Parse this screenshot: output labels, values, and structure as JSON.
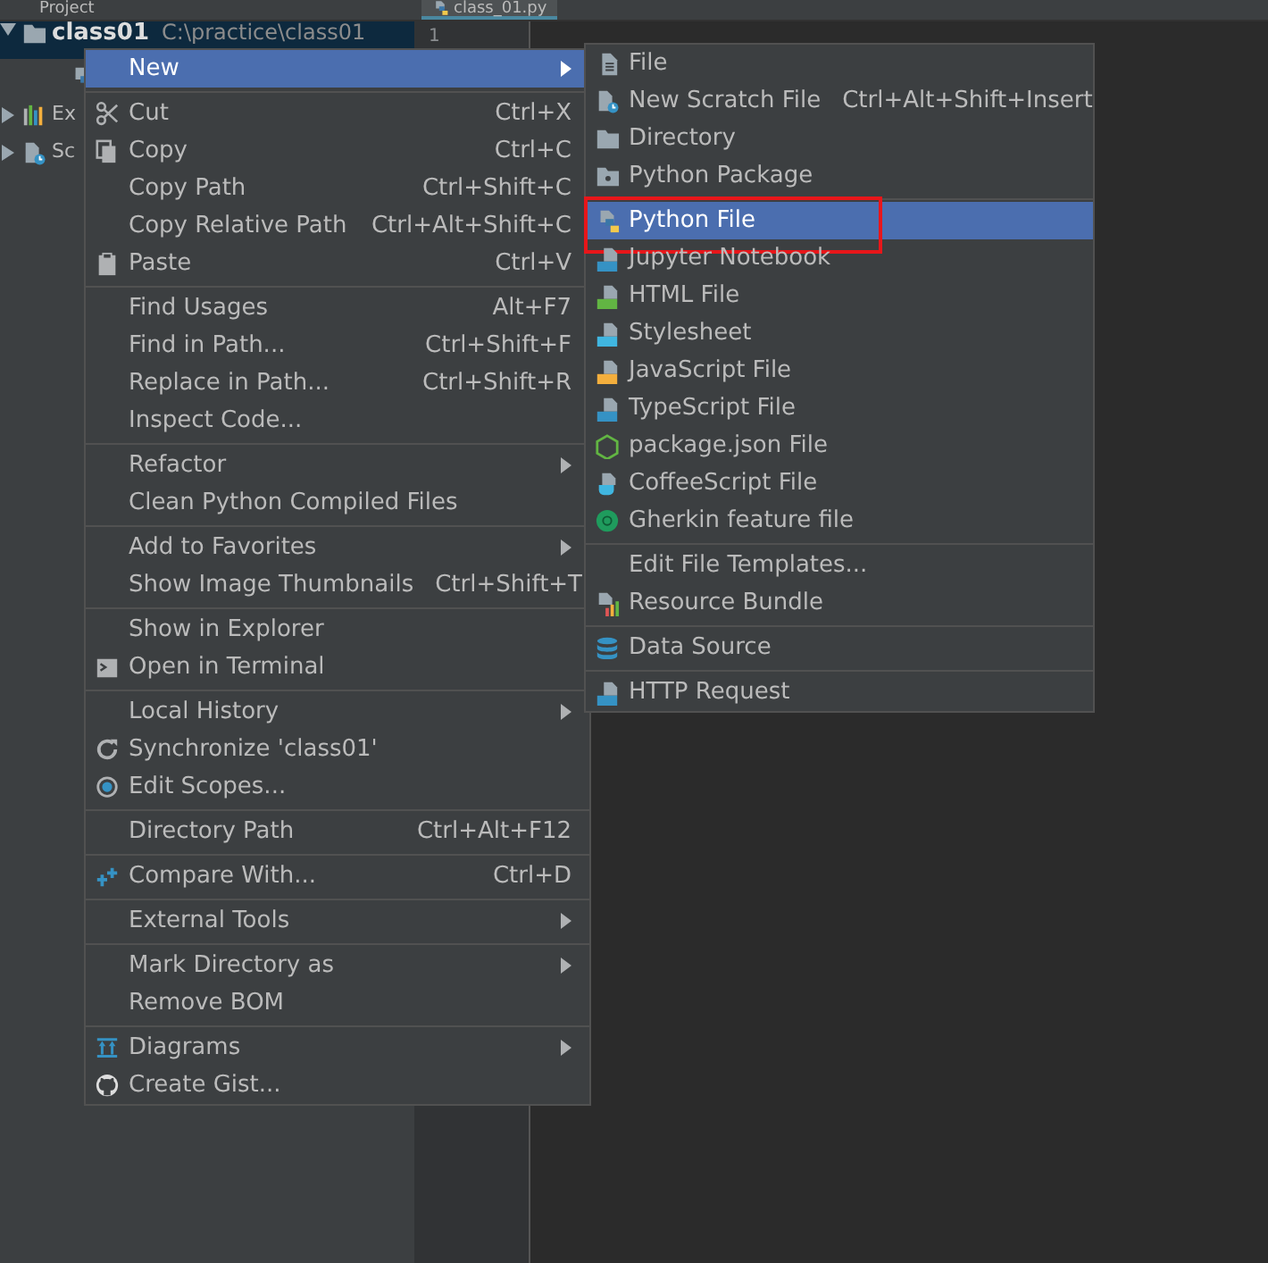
{
  "toolbar": {
    "title": "Project"
  },
  "editor_tab": {
    "label": "class_01.py"
  },
  "gutter": {
    "line": "1"
  },
  "project_tree": [
    {
      "kind": "folder",
      "label": "class01",
      "path": "C:\\practice\\class01",
      "selected": true,
      "expanded": true,
      "children": [
        {
          "kind": "python",
          "selected": false
        }
      ]
    },
    {
      "kind": "bars",
      "label": "Ex",
      "selected": false,
      "expanded": false
    },
    {
      "kind": "scratch",
      "label": "Sc",
      "selected": false,
      "expanded": false
    }
  ],
  "context_menu": [
    [
      {
        "label": "New",
        "kind": "plain",
        "submenu": true,
        "selected": true
      }
    ],
    [
      {
        "label": "Cut",
        "shortcut": "Ctrl+X",
        "kind": "scissors",
        "selected": false
      },
      {
        "label": "Copy",
        "shortcut": "Ctrl+C",
        "kind": "copy",
        "selected": false
      },
      {
        "label": "Copy Path",
        "shortcut": "Ctrl+Shift+C",
        "kind": "plain",
        "selected": false
      },
      {
        "label": "Copy Relative Path",
        "shortcut": "Ctrl+Alt+Shift+C",
        "kind": "plain",
        "selected": false
      },
      {
        "label": "Paste",
        "shortcut": "Ctrl+V",
        "kind": "paste",
        "selected": false
      }
    ],
    [
      {
        "label": "Find Usages",
        "shortcut": "Alt+F7",
        "kind": "plain",
        "selected": false
      },
      {
        "label": "Find in Path...",
        "shortcut": "Ctrl+Shift+F",
        "kind": "plain",
        "selected": false
      },
      {
        "label": "Replace in Path...",
        "shortcut": "Ctrl+Shift+R",
        "kind": "plain",
        "selected": false
      },
      {
        "label": "Inspect Code...",
        "kind": "plain",
        "selected": false
      }
    ],
    [
      {
        "label": "Refactor",
        "kind": "plain",
        "submenu": true,
        "selected": false
      },
      {
        "label": "Clean Python Compiled Files",
        "kind": "plain",
        "selected": false
      }
    ],
    [
      {
        "label": "Add to Favorites",
        "kind": "plain",
        "submenu": true,
        "selected": false
      },
      {
        "label": "Show Image Thumbnails",
        "shortcut": "Ctrl+Shift+T",
        "kind": "plain",
        "selected": false
      }
    ],
    [
      {
        "label": "Show in Explorer",
        "kind": "plain",
        "selected": false
      },
      {
        "label": "Open in Terminal",
        "kind": "terminal",
        "selected": false
      }
    ],
    [
      {
        "label": "Local History",
        "kind": "plain",
        "submenu": true,
        "selected": false
      },
      {
        "label": "Synchronize 'class01'",
        "kind": "sync",
        "selected": false
      },
      {
        "label": "Edit Scopes...",
        "kind": "scope",
        "selected": false
      }
    ],
    [
      {
        "label": "Directory Path",
        "shortcut": "Ctrl+Alt+F12",
        "kind": "plain",
        "selected": false
      }
    ],
    [
      {
        "label": "Compare With...",
        "shortcut": "Ctrl+D",
        "kind": "compare",
        "selected": false
      }
    ],
    [
      {
        "label": "External Tools",
        "kind": "plain",
        "submenu": true,
        "selected": false
      }
    ],
    [
      {
        "label": "Mark Directory as",
        "kind": "plain",
        "submenu": true,
        "selected": false
      },
      {
        "label": "Remove BOM",
        "kind": "plain",
        "selected": false
      }
    ],
    [
      {
        "label": "Diagrams",
        "submenu": true,
        "kind": "diagrams",
        "selected": false
      },
      {
        "label": "Create Gist...",
        "kind": "github",
        "selected": false
      }
    ]
  ],
  "new_submenu": [
    [
      {
        "label": "File",
        "kind": "file",
        "selected": false,
        "outlined": false
      },
      {
        "label": "New Scratch File",
        "shortcut": "Ctrl+Alt+Shift+Insert",
        "kind": "scratch",
        "selected": false,
        "outlined": false
      },
      {
        "label": "Directory",
        "kind": "folder",
        "selected": false,
        "outlined": false
      },
      {
        "label": "Python Package",
        "kind": "package",
        "selected": false,
        "outlined": false
      }
    ],
    [
      {
        "label": "Python File",
        "kind": "python",
        "selected": true,
        "outlined": true
      },
      {
        "label": "Jupyter Notebook",
        "kind": "jupyter",
        "selected": false,
        "outlined": false
      },
      {
        "label": "HTML File",
        "kind": "html",
        "selected": false,
        "outlined": false
      },
      {
        "label": "Stylesheet",
        "kind": "css",
        "selected": false,
        "outlined": false
      },
      {
        "label": "JavaScript File",
        "kind": "js",
        "selected": false,
        "outlined": false
      },
      {
        "label": "TypeScript File",
        "kind": "ts",
        "selected": false,
        "outlined": false
      },
      {
        "label": "package.json File",
        "kind": "nodejs",
        "selected": false,
        "outlined": false
      },
      {
        "label": "CoffeeScript File",
        "kind": "coffee",
        "selected": false,
        "outlined": false
      },
      {
        "label": "Gherkin feature file",
        "kind": "gherkin",
        "selected": false,
        "outlined": false
      }
    ],
    [
      {
        "label": "Edit File Templates...",
        "kind": "plain",
        "selected": false,
        "outlined": false
      },
      {
        "label": "Resource Bundle",
        "kind": "resource",
        "selected": false,
        "outlined": false
      }
    ],
    [
      {
        "label": "Data Source",
        "kind": "database",
        "selected": false,
        "outlined": false
      }
    ],
    [
      {
        "label": "HTTP Request",
        "kind": "api",
        "selected": false,
        "outlined": false
      }
    ]
  ]
}
